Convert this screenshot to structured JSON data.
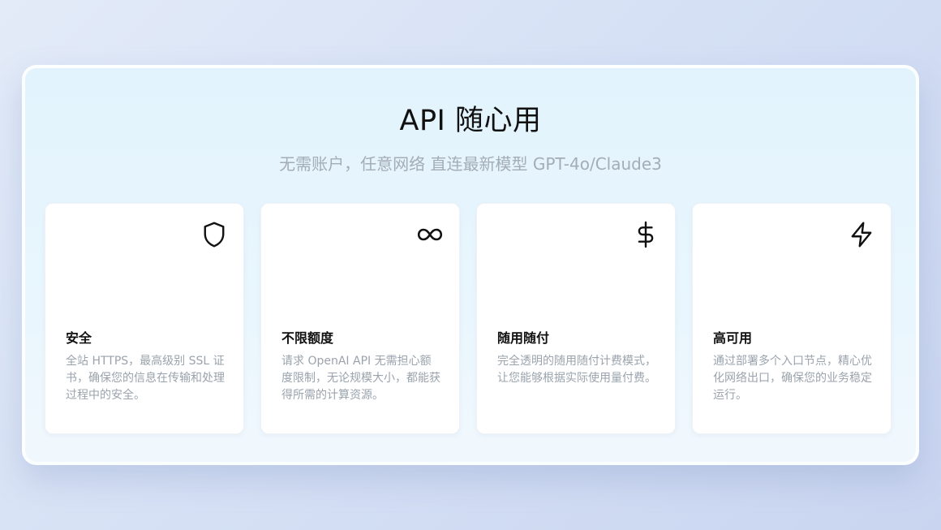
{
  "header": {
    "title": "API 随心用",
    "subtitle": "无需账户，任意网络 直连最新模型 GPT-4o/Claude3"
  },
  "features": [
    {
      "icon": "shield-icon",
      "title": "安全",
      "description": "全站 HTTPS，最高级别 SSL 证书，确保您的信息在传输和处理过程中的安全。"
    },
    {
      "icon": "infinity-icon",
      "title": "不限额度",
      "description": "请求 OpenAI API 无需担心额度限制，无论规模大小，都能获得所需的计算资源。"
    },
    {
      "icon": "dollar-icon",
      "title": "随用随付",
      "description": "完全透明的随用随付计费模式，让您能够根据实际使用量付费。"
    },
    {
      "icon": "lightning-icon",
      "title": "高可用",
      "description": "通过部署多个入口节点，精心优化网络出口，确保您的业务稳定运行。"
    }
  ],
  "colors": {
    "title": "#111111",
    "subtitle": "#a3acb7",
    "description": "#9aa3ad",
    "panel_background": "#e2f3fd",
    "card_background": "#ffffff"
  }
}
